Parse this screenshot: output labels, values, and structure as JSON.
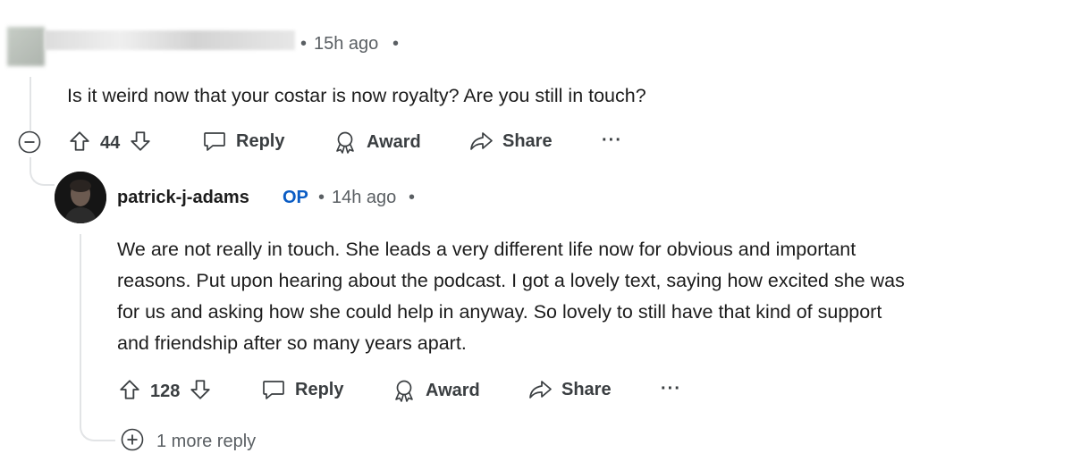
{
  "comment": {
    "timestamp": "15h ago",
    "separator": "•",
    "text": "Is it weird now that your costar is now royalty? Are you still in touch?",
    "votes": "44",
    "actions": {
      "reply": "Reply",
      "award": "Award",
      "share": "Share",
      "more": "···"
    }
  },
  "reply": {
    "username": "patrick-j-adams",
    "op_badge": "OP",
    "separator": "•",
    "timestamp": "14h ago",
    "text_lines": [
      "We are not really in touch. She leads a very different life now for obvious and important",
      "reasons. Put upon hearing about the podcast. I got a lovely text, saying how excited she was",
      "for us and asking how she could help in anyway. So lovely to still have that kind of support",
      "and friendship after so many years apart."
    ],
    "votes": "128",
    "actions": {
      "reply": "Reply",
      "award": "Award",
      "share": "Share",
      "more": "···"
    },
    "more_replies": "1 more reply"
  },
  "colors": {
    "op": "#0a5cc4",
    "text": "#1c1c1c",
    "muted": "#5a5f63",
    "thread": "#e2e4e6"
  },
  "icons": [
    "collapse-icon",
    "upvote-icon",
    "downvote-icon",
    "reply-icon",
    "award-icon",
    "share-icon",
    "more-icon",
    "expand-icon"
  ]
}
